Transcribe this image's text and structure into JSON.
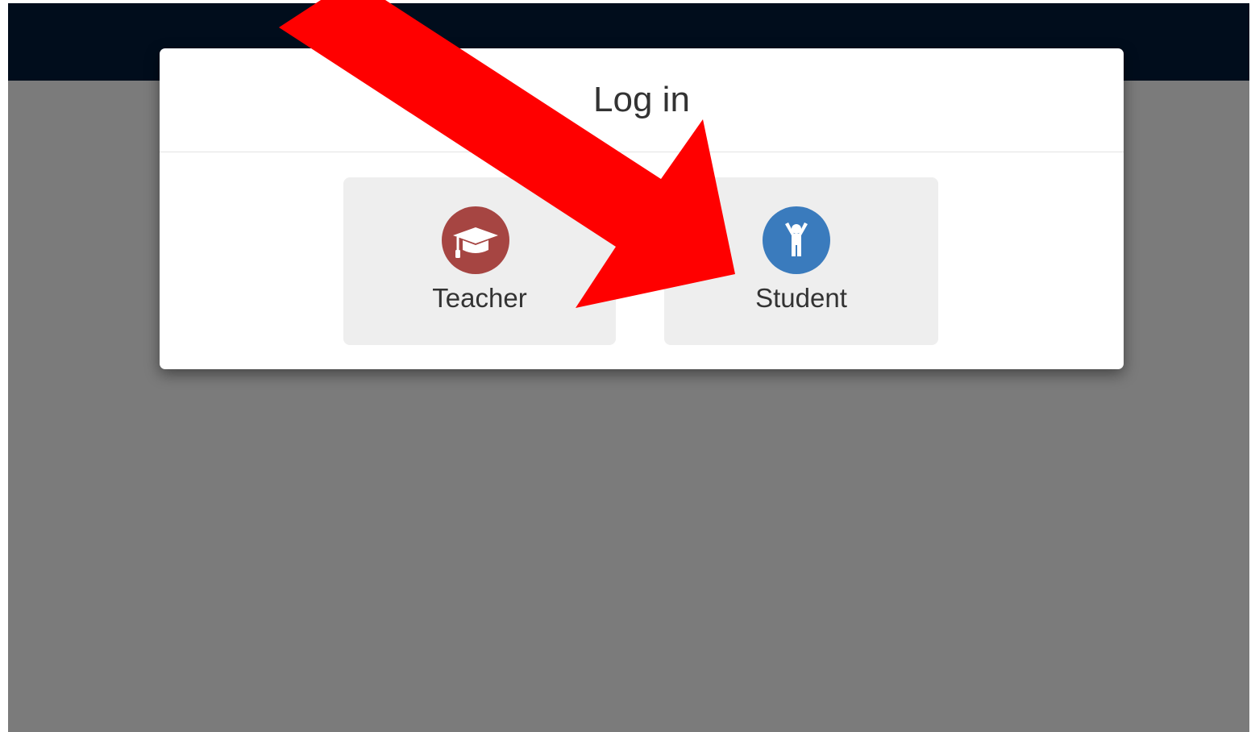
{
  "modal": {
    "title": "Log in"
  },
  "roles": [
    {
      "label": "Teacher",
      "icon": "graduation-cap-icon",
      "color": "#a64542"
    },
    {
      "label": "Student",
      "icon": "child-icon",
      "color": "#3a7bbd"
    }
  ],
  "colors": {
    "topbar": "#010d1c",
    "backdrop": "#7b7b7b",
    "button_bg": "#eeeeee",
    "annotation_arrow": "#ff0000"
  }
}
